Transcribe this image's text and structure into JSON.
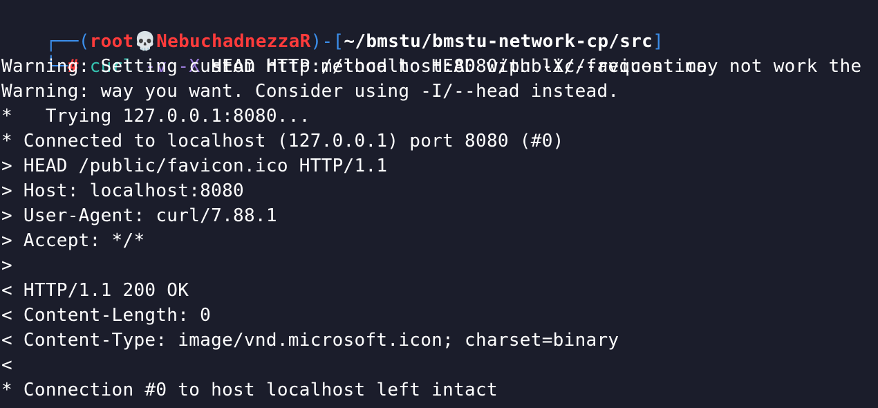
{
  "prompt": {
    "frame_top_left": "┌──(",
    "user": "root",
    "skull_icon": "💀",
    "host": "NebuchadnezzaR",
    "frame_mid": ")-[",
    "path": "~/bmstu/bmstu-network-cp/src",
    "frame_end": "]",
    "frame_bottom_left": "└─",
    "symbol": "#",
    "command": "curl",
    "flag_v": "-v",
    "flag_x": "-X",
    "args": "HEAD http://localhost:8080/public/favicon.ico"
  },
  "output": [
    "Warning: Setting custom HTTP method to HEAD with -X/--request may not work the",
    "Warning: way you want. Consider using -I/--head instead.",
    "*   Trying 127.0.0.1:8080...",
    "* Connected to localhost (127.0.0.1) port 8080 (#0)",
    "> HEAD /public/favicon.ico HTTP/1.1",
    "> Host: localhost:8080",
    "> User-Agent: curl/7.88.1",
    "> Accept: */*",
    ">",
    "< HTTP/1.1 200 OK",
    "< Content-Length: 0",
    "< Content-Type: image/vnd.microsoft.icon; charset=binary",
    "<",
    "* Connection #0 to host localhost left intact"
  ],
  "colors": {
    "background": "#1b1d2b",
    "frame": "#3b8eea",
    "user_host": "#ff3b3b",
    "command": "#35c2b0",
    "flags": "#9a7bd8",
    "text": "#ffffff"
  }
}
